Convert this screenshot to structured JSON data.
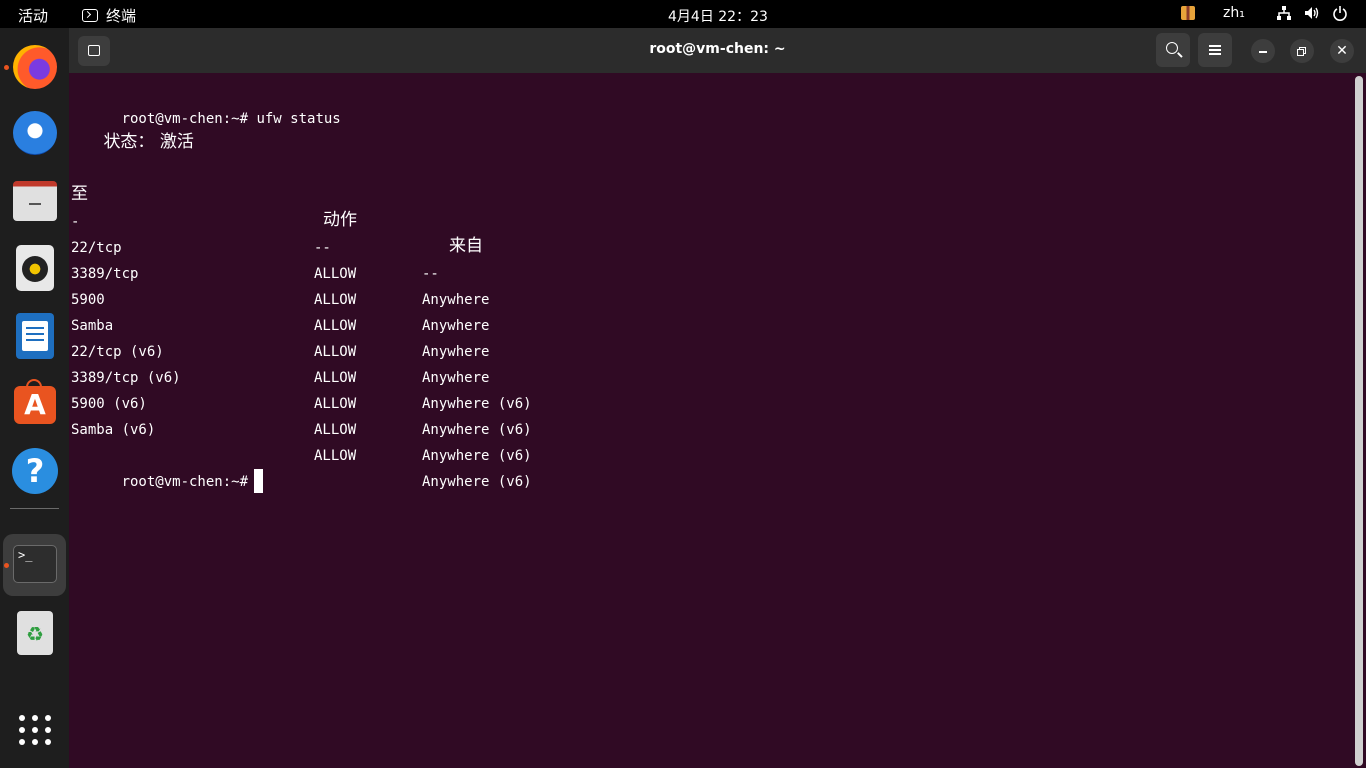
{
  "topbar": {
    "activities": "活动",
    "app_name": "终端",
    "clock": "4月4日  22：23",
    "input_method": "zh₁"
  },
  "dock": {
    "items": [
      {
        "name": "firefox-icon",
        "running": true
      },
      {
        "name": "thunderbird-icon",
        "running": false
      },
      {
        "name": "files-icon",
        "running": false
      },
      {
        "name": "rhythmbox-icon",
        "running": false
      },
      {
        "name": "libreoffice-writer-icon",
        "running": false
      },
      {
        "name": "ubuntu-software-icon",
        "running": false
      },
      {
        "name": "help-icon",
        "running": false
      },
      {
        "name": "terminal-icon",
        "running": true
      },
      {
        "name": "trash-icon",
        "running": false
      },
      {
        "name": "show-apps-icon",
        "running": false
      }
    ],
    "terminal_glyph": ">_",
    "store_glyph": "A",
    "help_glyph": "?",
    "trash_glyph": "♻"
  },
  "window": {
    "title": "root@vm-chen: ~",
    "close_glyph": "✕"
  },
  "terminal": {
    "prompt": "root@vm-chen:~#",
    "command": "ufw status",
    "status_label": "状态：",
    "status_value": "激活",
    "headers": {
      "to": "至",
      "action": "动作",
      "from": "来自"
    },
    "separators": {
      "to": "-",
      "action": "--",
      "from": "--"
    },
    "rules": [
      {
        "to": "22/tcp",
        "action": "ALLOW",
        "from": "Anywhere"
      },
      {
        "to": "3389/tcp",
        "action": "ALLOW",
        "from": "Anywhere"
      },
      {
        "to": "5900",
        "action": "ALLOW",
        "from": "Anywhere"
      },
      {
        "to": "Samba",
        "action": "ALLOW",
        "from": "Anywhere"
      },
      {
        "to": "22/tcp (v6)",
        "action": "ALLOW",
        "from": "Anywhere (v6)"
      },
      {
        "to": "3389/tcp (v6)",
        "action": "ALLOW",
        "from": "Anywhere (v6)"
      },
      {
        "to": "5900 (v6)",
        "action": "ALLOW",
        "from": "Anywhere (v6)"
      },
      {
        "to": "Samba (v6)",
        "action": "ALLOW",
        "from": "Anywhere (v6)"
      }
    ],
    "final_prompt": "root@vm-chen:~#"
  }
}
